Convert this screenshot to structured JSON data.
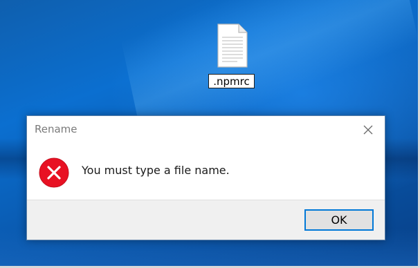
{
  "desktop": {
    "file": {
      "name": ".npmrc",
      "icon": "text-file-icon"
    },
    "colors": {
      "background": "#0b6fd0"
    }
  },
  "dialog": {
    "title": "Rename",
    "message": "You must type a file name.",
    "icon": "error-icon",
    "close_icon": "close-icon",
    "ok_label": "OK",
    "colors": {
      "error_red": "#e81123",
      "button_border": "#0078d7",
      "footer_bg": "#f0f0f0"
    }
  }
}
